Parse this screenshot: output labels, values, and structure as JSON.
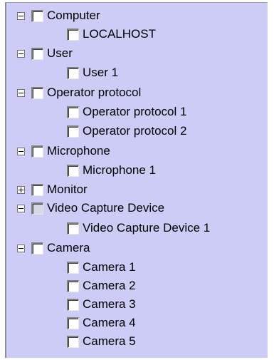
{
  "tree": {
    "nodes": [
      {
        "label": "Computer",
        "level": 0,
        "toggle": "expanded",
        "checked": false,
        "enabled": true
      },
      {
        "label": "LOCALHOST",
        "level": 1,
        "toggle": "none",
        "checked": false,
        "enabled": true
      },
      {
        "label": "User",
        "level": 0,
        "toggle": "expanded",
        "checked": false,
        "enabled": true
      },
      {
        "label": "User 1",
        "level": 1,
        "toggle": "none",
        "checked": false,
        "enabled": true
      },
      {
        "label": "Operator protocol",
        "level": 0,
        "toggle": "expanded",
        "checked": false,
        "enabled": true
      },
      {
        "label": "Operator protocol 1",
        "level": 1,
        "toggle": "none",
        "checked": false,
        "enabled": true
      },
      {
        "label": "Operator protocol 2",
        "level": 1,
        "toggle": "none",
        "checked": false,
        "enabled": true
      },
      {
        "label": "Microphone",
        "level": 0,
        "toggle": "expanded",
        "checked": false,
        "enabled": true
      },
      {
        "label": "Microphone 1",
        "level": 1,
        "toggle": "none",
        "checked": false,
        "enabled": true
      },
      {
        "label": "Monitor",
        "level": 0,
        "toggle": "collapsed",
        "checked": false,
        "enabled": true
      },
      {
        "label": "Video Capture Device",
        "level": 0,
        "toggle": "expanded",
        "checked": false,
        "enabled": false
      },
      {
        "label": "Video Capture Device 1",
        "level": 1,
        "toggle": "none",
        "checked": false,
        "enabled": true
      },
      {
        "label": "Camera",
        "level": 0,
        "toggle": "expanded",
        "checked": false,
        "enabled": true
      },
      {
        "label": "Camera 1",
        "level": 1,
        "toggle": "none",
        "checked": false,
        "enabled": true
      },
      {
        "label": "Camera 2",
        "level": 1,
        "toggle": "none",
        "checked": false,
        "enabled": true
      },
      {
        "label": "Camera 3",
        "level": 1,
        "toggle": "none",
        "checked": false,
        "enabled": true
      },
      {
        "label": "Camera 4",
        "level": 1,
        "toggle": "none",
        "checked": false,
        "enabled": true
      },
      {
        "label": "Camera 5",
        "level": 1,
        "toggle": "none",
        "checked": false,
        "enabled": true
      }
    ]
  }
}
